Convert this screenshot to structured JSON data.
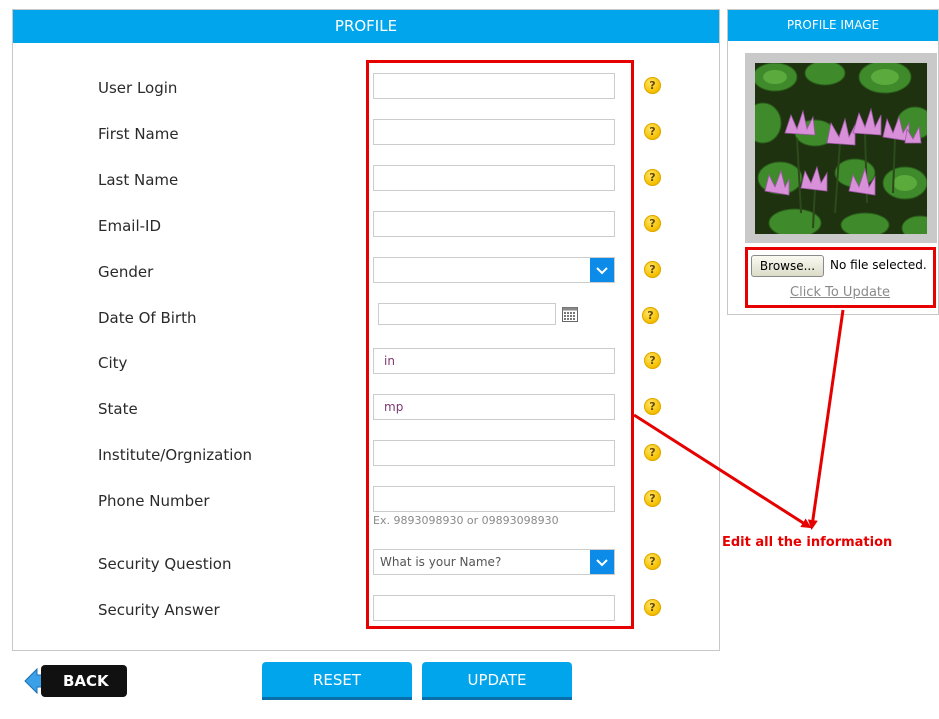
{
  "profile": {
    "title": "PROFILE",
    "fields": [
      {
        "label": "User Login",
        "value": "",
        "type": "text"
      },
      {
        "label": "First Name",
        "value": "",
        "type": "text"
      },
      {
        "label": "Last Name",
        "value": "",
        "type": "text"
      },
      {
        "label": "Email-ID",
        "value": "",
        "type": "text"
      },
      {
        "label": "Gender",
        "value": "",
        "type": "select"
      },
      {
        "label": "Date Of Birth",
        "value": "",
        "type": "date"
      },
      {
        "label": "City",
        "value": "in",
        "type": "text"
      },
      {
        "label": "State",
        "value": "mp",
        "type": "text"
      },
      {
        "label": "Institute/Orgnization",
        "value": "",
        "type": "text"
      },
      {
        "label": "Phone Number",
        "value": "",
        "type": "text",
        "hint": "Ex. 9893098930 or 09893098930"
      },
      {
        "label": "Security Question",
        "value": "What is your Name?",
        "type": "select"
      },
      {
        "label": "Security Answer",
        "value": "",
        "type": "text"
      }
    ],
    "help_symbol": "?"
  },
  "profile_image": {
    "title": "PROFILE IMAGE",
    "browse_label": "Browse...",
    "file_status": "No file selected.",
    "update_link": "Click To Update"
  },
  "annotation": {
    "text": "Edit all the information",
    "color": "#e60000"
  },
  "actions": {
    "back": "BACK",
    "reset": "RESET",
    "update": "UPDATE"
  },
  "colors": {
    "accent": "#00a5ec",
    "select_arrow": "#0c8be8",
    "highlight": "#e60000"
  },
  "icons": {
    "help": "help-icon",
    "calendar": "calendar-icon",
    "dropdown": "chevron-down-icon",
    "back": "arrow-left-icon"
  }
}
